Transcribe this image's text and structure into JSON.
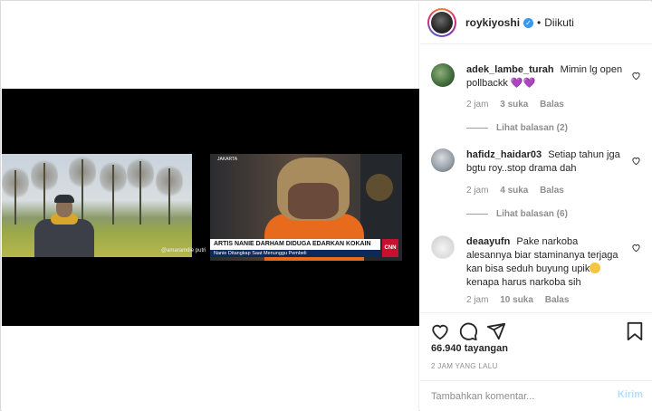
{
  "post": {
    "username": "roykiyoshi",
    "follow_state": "Diikuti",
    "separator": "•"
  },
  "video": {
    "watermark": "@amaramdie putri",
    "news_location": "JAKARTA",
    "news_headline": "ARTIS NANIE DARHAM DIDUGA EDARKAN KOKAIN",
    "news_subline": "Nanie Ditangkap Saat Menunggu Pembeli",
    "news_logo": "CNN"
  },
  "comments": [
    {
      "username": "adek_lambe_turah",
      "text": "Mimin lg open pollbackk",
      "emoji": "💜💜",
      "time": "2 jam",
      "likes": "3 suka",
      "reply_label": "Balas",
      "view_replies": "Lihat balasan (2)"
    },
    {
      "username": "hafidz_haidar03",
      "text": "Setiap tahun jga bgtu roy..stop drama dah",
      "time": "2 jam",
      "likes": "4 suka",
      "reply_label": "Balas",
      "view_replies": "Lihat balasan (6)"
    },
    {
      "username": "deaayufn",
      "text_before": "Pake narkoba alesannya biar staminanya terjaga kan bisa seduh buyung upik",
      "text_after": "kenapa harus narkoba sih",
      "time": "2 jam",
      "likes": "10 suka",
      "reply_label": "Balas"
    }
  ],
  "stats": {
    "views": "66.940 tayangan",
    "time_ago": "2 JAM YANG LALU"
  },
  "comment_box": {
    "placeholder": "Tambahkan komentar...",
    "send_label": "Kirim"
  },
  "icons": [
    "verified-icon",
    "heart-icon",
    "comment-icon",
    "share-icon",
    "bookmark-icon"
  ],
  "colors": {
    "verified": "#3897f0",
    "muted": "#8e8e8e",
    "send_disabled": "#b2dffc"
  }
}
